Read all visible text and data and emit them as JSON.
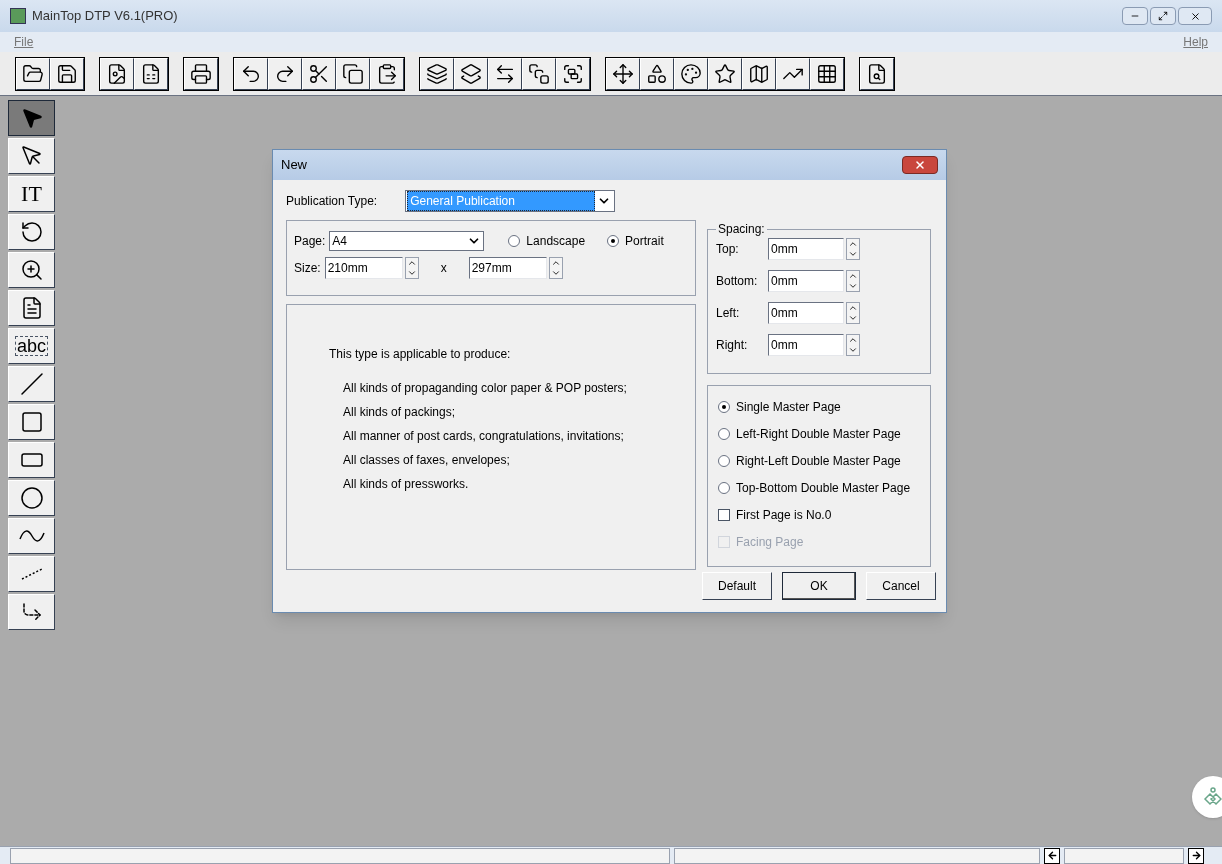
{
  "window": {
    "title": "MainTop DTP V6.1(PRO)"
  },
  "menu": [
    {
      "label": "File"
    },
    {
      "label": "Help"
    }
  ],
  "tools": [
    {
      "kind": "pointer",
      "selected": true
    },
    {
      "kind": "node",
      "selected": false
    },
    {
      "kind": "text",
      "label": "IT",
      "selected": false
    },
    {
      "kind": "rotate",
      "selected": false
    },
    {
      "kind": "zoom",
      "selected": false
    },
    {
      "kind": "page",
      "selected": false
    },
    {
      "kind": "textbox",
      "label": "abc",
      "selected": false
    },
    {
      "kind": "line",
      "selected": false
    },
    {
      "kind": "rect",
      "selected": false
    },
    {
      "kind": "roundrect",
      "selected": false
    },
    {
      "kind": "ellipse",
      "selected": false
    },
    {
      "kind": "curve",
      "selected": false
    },
    {
      "kind": "polyline",
      "selected": false
    },
    {
      "kind": "frame",
      "selected": false
    }
  ],
  "dialog": {
    "title": "New",
    "publication_type": {
      "label": "Publication Type:",
      "value": "General Publication"
    },
    "page": {
      "label": "Page:",
      "value": "A4"
    },
    "orientation": [
      {
        "label": "Landscape",
        "selected": false
      },
      {
        "label": "Portrait",
        "selected": true
      }
    ],
    "size": {
      "label": "Size:",
      "width": "210mm",
      "separator": "x",
      "height": "297mm"
    },
    "description": {
      "intro": "This type is applicable to produce:",
      "items": [
        "All kinds of propaganding color paper & POP posters;",
        "All kinds of packings;",
        "All manner of post cards, congratulations, invitations;",
        "All classes of faxes, envelopes;",
        "All kinds of pressworks."
      ]
    },
    "spacing": {
      "title": "Spacing:",
      "fields": [
        {
          "label": "Top:",
          "value": "0mm"
        },
        {
          "label": "Bottom:",
          "value": "0mm"
        },
        {
          "label": "Left:",
          "value": "0mm"
        },
        {
          "label": "Right:",
          "value": "0mm"
        }
      ]
    },
    "master_page": [
      {
        "label": "Single Master Page",
        "selected": true
      },
      {
        "label": "Left-Right Double Master Page",
        "selected": false
      },
      {
        "label": "Right-Left Double Master Page",
        "selected": false
      },
      {
        "label": "Top-Bottom Double Master Page",
        "selected": false
      }
    ],
    "options": [
      {
        "label": "First Page is No.0",
        "checked": false,
        "disabled": false
      },
      {
        "label": "Facing Page",
        "checked": false,
        "disabled": true
      }
    ],
    "buttons": [
      {
        "label": "Default",
        "default": false
      },
      {
        "label": "OK",
        "default": true
      },
      {
        "label": "Cancel",
        "default": false
      }
    ]
  }
}
